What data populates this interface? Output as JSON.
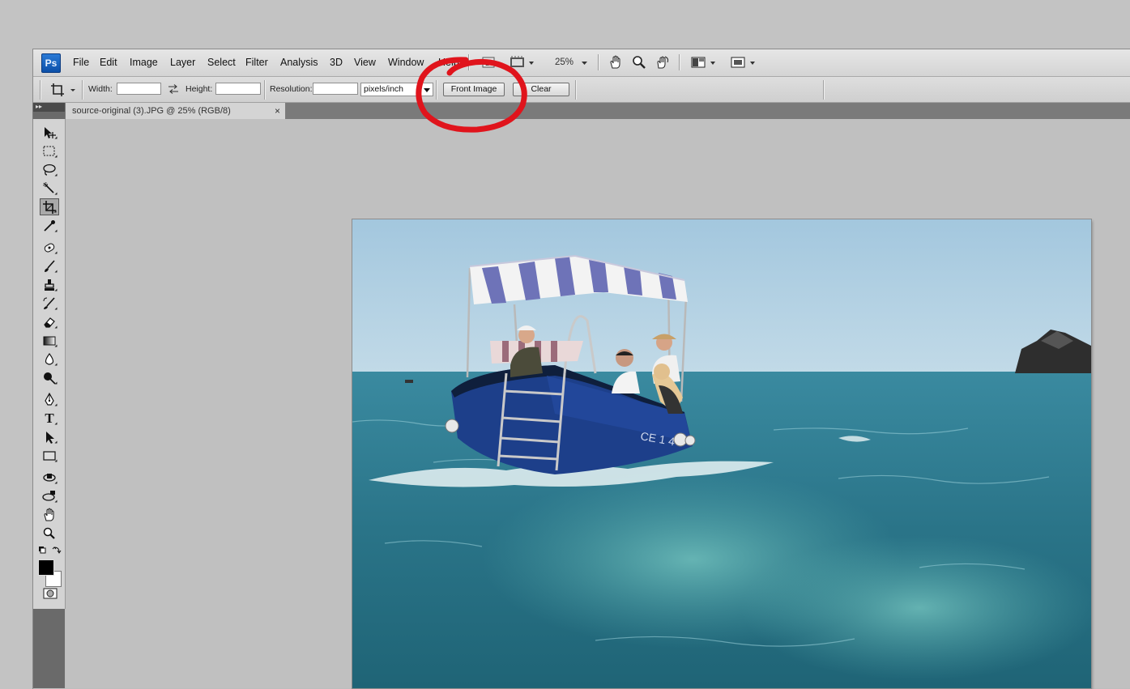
{
  "app": {
    "logo": "Ps"
  },
  "menu": [
    "File",
    "Edit",
    "Image",
    "Layer",
    "Select",
    "Filter",
    "Analysis",
    "3D",
    "View",
    "Window",
    "Help"
  ],
  "menubar_icons": [
    "bridge-icon",
    "mini-bridge-icon",
    "zoom-menu-icon",
    "hand-icon",
    "zoom-icon",
    "rotate-view-icon",
    "arrange-documents-icon",
    "screen-mode-icon"
  ],
  "zoom": "25%",
  "options": {
    "width_label": "Width:",
    "width_value": "",
    "height_label": "Height:",
    "height_value": "",
    "resolution_label": "Resolution:",
    "resolution_value": "",
    "units": "pixels/inch",
    "front_image": "Front Image",
    "clear": "Clear"
  },
  "document": {
    "tab_title": "source-original (3).JPG @ 25% (RGB/8)",
    "close": "×"
  },
  "tools": [
    "move",
    "rect-marquee",
    "lasso",
    "quick-select",
    "crop",
    "eyedropper",
    "spot-healing",
    "brush",
    "clone-stamp",
    "history-brush",
    "eraser",
    "gradient",
    "blur",
    "dodge",
    "pen",
    "type",
    "path-select",
    "rectangle-shape",
    "3d-rotate",
    "3d-orbit",
    "hand",
    "zoom"
  ],
  "type_tool_glyph": "T",
  "colors": {
    "foreground": "#000000",
    "background": "#ffffff",
    "annotation": "#e0141c"
  },
  "annotation": {
    "shape": "hand-drawn red circle around Front Image button"
  }
}
